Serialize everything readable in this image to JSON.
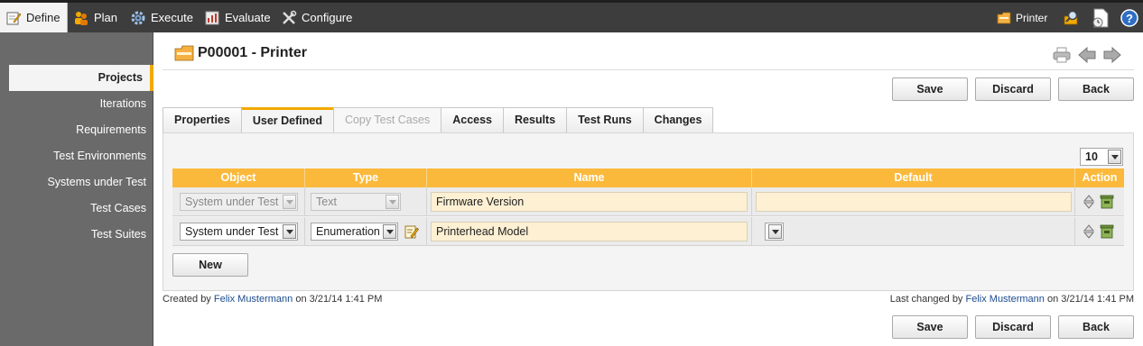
{
  "topbar": {
    "nav": [
      {
        "label": "Define",
        "icon": "define-icon"
      },
      {
        "label": "Plan",
        "icon": "plan-icon"
      },
      {
        "label": "Execute",
        "icon": "execute-gear-icon"
      },
      {
        "label": "Evaluate",
        "icon": "evaluate-icon"
      },
      {
        "label": "Configure",
        "icon": "configure-tools-icon"
      }
    ],
    "project_label": "Printer"
  },
  "sidebar": {
    "items": [
      {
        "label": "Projects"
      },
      {
        "label": "Iterations"
      },
      {
        "label": "Requirements"
      },
      {
        "label": "Test Environments"
      },
      {
        "label": "Systems under Test"
      },
      {
        "label": "Test Cases"
      },
      {
        "label": "Test Suites"
      }
    ]
  },
  "page": {
    "title": "P00001 - Printer"
  },
  "buttons": {
    "save": "Save",
    "discard": "Discard",
    "back": "Back",
    "new": "New"
  },
  "tabs": [
    {
      "label": "Properties"
    },
    {
      "label": "User Defined"
    },
    {
      "label": "Copy Test Cases"
    },
    {
      "label": "Access"
    },
    {
      "label": "Results"
    },
    {
      "label": "Test Runs"
    },
    {
      "label": "Changes"
    }
  ],
  "pager": {
    "page_size": "10"
  },
  "grid": {
    "columns": [
      "Object",
      "Type",
      "Name",
      "Default",
      "Action"
    ],
    "rows": [
      {
        "object": "System under Test",
        "type": "Text",
        "name": "Firmware Version",
        "default": ""
      },
      {
        "object": "System under Test",
        "type": "Enumeration",
        "name": "Printerhead Model",
        "default": ""
      }
    ]
  },
  "footer": {
    "created_prefix": "Created by",
    "created_by": "Felix Mustermann",
    "created_on": "on 3/21/14 1:41 PM",
    "changed_prefix": "Last changed by",
    "changed_by": "Felix Mustermann",
    "changed_on": "on 3/21/14 1:41 PM"
  },
  "colors": {
    "accent": "#f2a900",
    "grid_header": "#fbb93b",
    "topbar": "#3d3d3d",
    "sidebar": "#6a6a6a"
  }
}
